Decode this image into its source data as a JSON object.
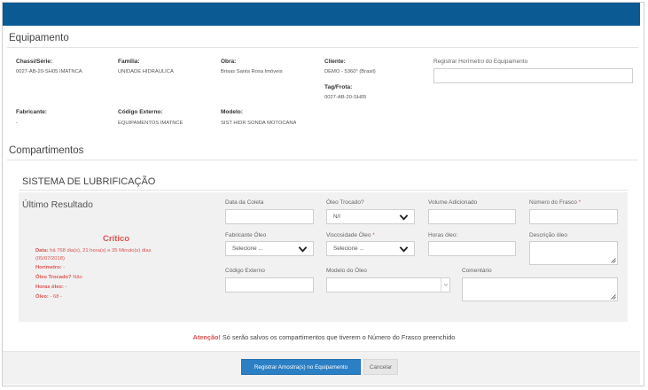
{
  "equipamento": {
    "title": "Equipamento",
    "chassi": {
      "label": "Chassi/Série:",
      "value": "0027-AB-20-SH05 IMATNCA"
    },
    "familia": {
      "label": "Família:",
      "value": "UNIDADE HIDRÁULICA"
    },
    "obra": {
      "label": "Obra:",
      "value": "Brisas Santa Rosa Imóveis"
    },
    "cliente": {
      "label": "Cliente:",
      "value": "DEMO - 5360° (Brasil)"
    },
    "tag": {
      "label": "Tag/Frota:",
      "value": "0027-AB-20-SH05"
    },
    "fabricante": {
      "label": "Fabricante:",
      "value": "-"
    },
    "codigo_externo": {
      "label": "Código Externo:",
      "value": "EQUIPAMENTOS IMATNCE"
    },
    "modelo": {
      "label": "Modelo:",
      "value": "SIST HIDR SONDA MOTOCANA"
    },
    "horimetro": {
      "label": "Registrar Horímetro do Equipamento",
      "value": ""
    }
  },
  "compartimentos": {
    "title": "Compartimentos",
    "sistema_title": "SISTEMA DE LUBRIFICAÇÃO",
    "ultimo_title": "Último Resultado",
    "resultado": {
      "status": "Crítico",
      "data_label": "Data:",
      "data_value": "há 768 dia(s), 21 hora(s) e 35 Minuto(s) dias",
      "data_date": "(05/07/2018)",
      "horimetro_label": "Horímetro:",
      "horimetro_value": "-",
      "oleo_trocado_label": "Óleo Trocado?",
      "oleo_trocado_value": "Não",
      "horas_oleo_label": "Horas óleo:",
      "horas_oleo_value": "-",
      "oleo_label": "Óleo:",
      "oleo_value": "- 68 -"
    },
    "form": {
      "data_coleta": "Data da Coleta",
      "oleo_trocado": "Óleo Trocado?",
      "oleo_trocado_value": "N/I",
      "volume": "Volume Adicionado",
      "numero_frasco": "Número do Frasco",
      "fabricante_oleo": "Fabricante Óleo",
      "fabricante_placeholder": "Selecione ...",
      "viscosidade": "Viscosidade Óleo",
      "viscosidade_placeholder": "Selecione ...",
      "horas_oleo": "Horas óleo:",
      "descricao_oleo": "Descrição óleo",
      "codigo_externo": "Código Externo",
      "modelo_oleo": "Modelo do Óleo",
      "comentario": "Comentário",
      "required_mark": "*"
    }
  },
  "warning": {
    "strong": "Atenção!",
    "text": " Só serão salvos os compartimentos que tiverem o Número do Frasco preenchido"
  },
  "footer": {
    "register_button": "Registrar Amostra(s) no Equipamento",
    "cancel_button": "Cancelar"
  },
  "colors": {
    "header": "#0b5a94",
    "accent": "#2b7fc4",
    "critical": "#d9534f"
  }
}
